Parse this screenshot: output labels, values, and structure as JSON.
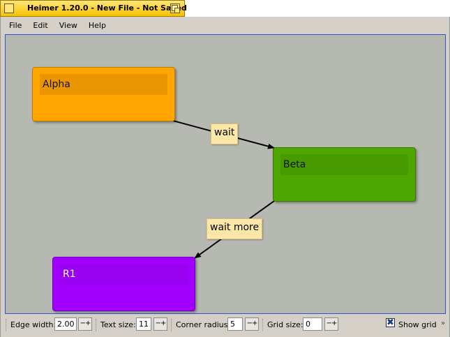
{
  "window": {
    "title": "Heimer 1.20.0 - New File - Not Saved"
  },
  "menu": [
    {
      "label": "File"
    },
    {
      "label": "Edit"
    },
    {
      "label": "View"
    },
    {
      "label": "Help"
    }
  ],
  "nodes": [
    {
      "id": "alpha",
      "label": "Alpha",
      "color": "#ffa500"
    },
    {
      "id": "beta",
      "label": "Beta",
      "color": "#4ea600"
    },
    {
      "id": "r1",
      "label": "R1",
      "color": "#a100ff"
    }
  ],
  "edges": [
    {
      "from": "Alpha",
      "to": "Beta",
      "label": "wait"
    },
    {
      "from": "Beta",
      "to": "R1",
      "label": "wait more"
    }
  ],
  "toolbar": {
    "edge_width": {
      "label": "Edge width:",
      "value": "2.00"
    },
    "text_size": {
      "label": "Text size:",
      "value": "11"
    },
    "corner_radius": {
      "label": "Corner radius:",
      "value": "5"
    },
    "grid_size": {
      "label": "Grid size:",
      "value": "0"
    },
    "show_grid": {
      "label": "Show grid",
      "checked": true
    },
    "stepper_glyph": "−+",
    "check_glyph": "✖",
    "more_glyph": "»"
  },
  "colors": {
    "canvas_background": "#b6b9b2",
    "edge_label_background": "#ffe7a8",
    "titlebar": "#f7c200"
  }
}
